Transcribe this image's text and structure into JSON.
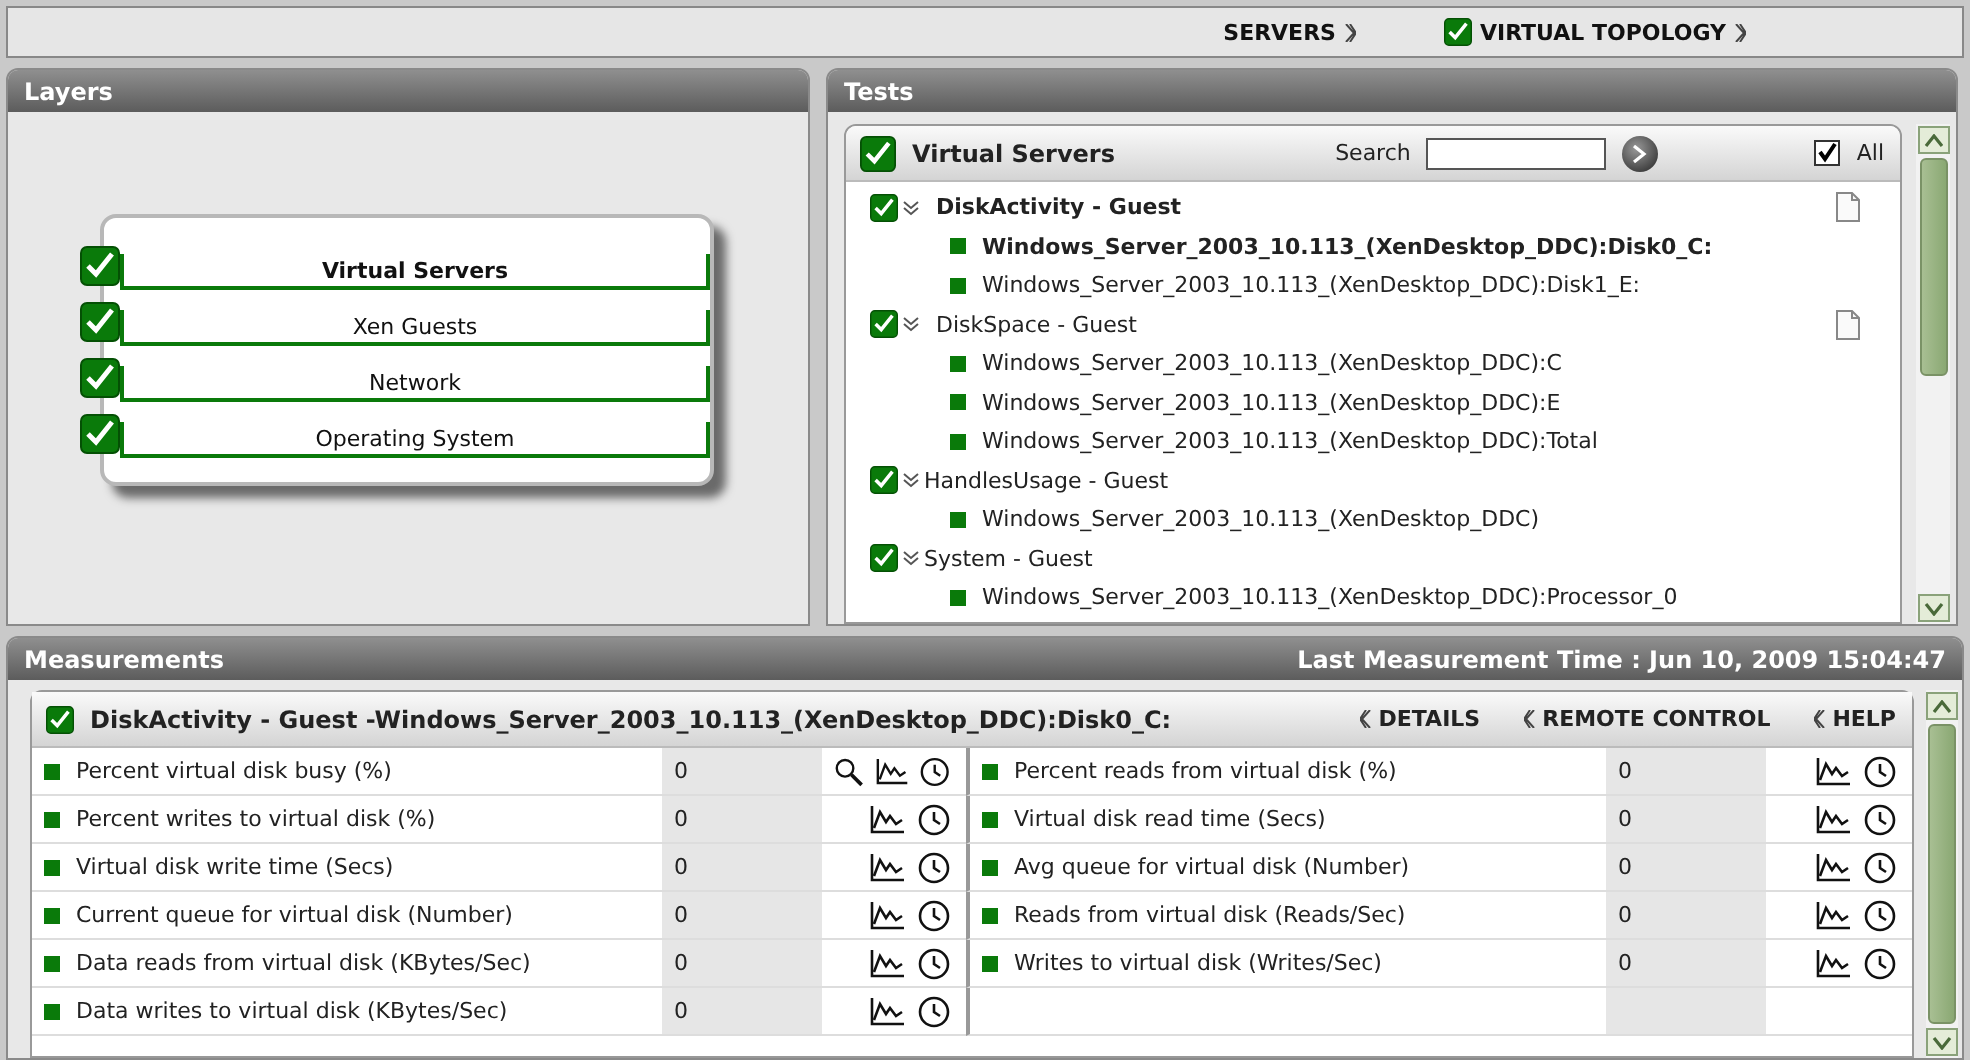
{
  "nav": {
    "items": [
      {
        "label": "SERVERS",
        "kind": "plain"
      },
      {
        "label": "VIRTUAL TOPOLOGY",
        "kind": "checkbox",
        "checked": true
      }
    ]
  },
  "layers": {
    "title": "Layers",
    "items": [
      {
        "label": "Virtual Servers",
        "checked": true,
        "selected": true
      },
      {
        "label": "Xen Guests",
        "checked": true,
        "selected": false
      },
      {
        "label": "Network",
        "checked": true,
        "selected": false
      },
      {
        "label": "Operating System",
        "checked": true,
        "selected": false
      }
    ]
  },
  "tests": {
    "title": "Tests",
    "header": {
      "title": "Virtual Servers",
      "checked": true,
      "search_label": "Search",
      "all_label": "All",
      "all_checked": true
    },
    "groups": [
      {
        "label": "DiskActivity - Guest",
        "checked": true,
        "expanded": true,
        "selected": true,
        "document": true,
        "children": [
          {
            "label": "Windows_Server_2003_10.113_(XenDesktop_DDC):Disk0_C:",
            "selected": true
          },
          {
            "label": "Windows_Server_2003_10.113_(XenDesktop_DDC):Disk1_E:",
            "selected": false
          }
        ]
      },
      {
        "label": "DiskSpace - Guest",
        "checked": true,
        "expanded": true,
        "selected": false,
        "document": true,
        "children": [
          {
            "label": "Windows_Server_2003_10.113_(XenDesktop_DDC):C",
            "selected": false
          },
          {
            "label": "Windows_Server_2003_10.113_(XenDesktop_DDC):E",
            "selected": false
          },
          {
            "label": "Windows_Server_2003_10.113_(XenDesktop_DDC):Total",
            "selected": false
          }
        ]
      },
      {
        "label": "HandlesUsage - Guest",
        "checked": true,
        "expanded": true,
        "selected": false,
        "document": false,
        "children": [
          {
            "label": "Windows_Server_2003_10.113_(XenDesktop_DDC)",
            "selected": false
          }
        ]
      },
      {
        "label": "System - Guest",
        "checked": true,
        "expanded": true,
        "selected": false,
        "document": false,
        "children": [
          {
            "label": "Windows_Server_2003_10.113_(XenDesktop_DDC):Processor_0",
            "selected": false
          }
        ]
      }
    ]
  },
  "measurements": {
    "title": "Measurements",
    "last_time": "Last Measurement Time : Jun 10, 2009 15:04:47",
    "header": {
      "title": "DiskActivity - Guest -Windows_Server_2003_10.113_(XenDesktop_DDC):Disk0_C:",
      "checked": true,
      "actions": [
        "DETAILS",
        "REMOTE CONTROL",
        "HELP"
      ]
    },
    "left": [
      {
        "label": "Percent virtual disk busy (%)",
        "value": "0",
        "kind": "zoomable"
      },
      {
        "label": "Percent writes to virtual disk (%)",
        "value": "0",
        "kind": "plain"
      },
      {
        "label": "Virtual disk write time (Secs)",
        "value": "0",
        "kind": "plain"
      },
      {
        "label": "Current queue for virtual disk (Number)",
        "value": "0",
        "kind": "plain"
      },
      {
        "label": "Data reads from virtual disk (KBytes/Sec)",
        "value": "0",
        "kind": "plain"
      },
      {
        "label": "Data writes to virtual disk (KBytes/Sec)",
        "value": "0",
        "kind": "plain"
      }
    ],
    "right": [
      {
        "label": "Percent reads from virtual disk (%)",
        "value": "0",
        "kind": "plain"
      },
      {
        "label": "Virtual disk read time (Secs)",
        "value": "0",
        "kind": "plain"
      },
      {
        "label": "Avg queue for virtual disk (Number)",
        "value": "0",
        "kind": "plain"
      },
      {
        "label": "Reads from virtual disk (Reads/Sec)",
        "value": "0",
        "kind": "plain"
      },
      {
        "label": "Writes to virtual disk (Writes/Sec)",
        "value": "0",
        "kind": "plain"
      }
    ]
  }
}
